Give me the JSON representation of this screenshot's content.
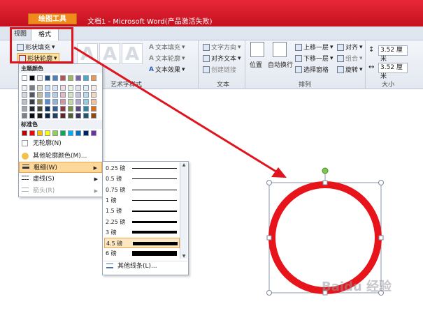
{
  "window": {
    "contextual_tab": "绘图工具",
    "title": "文档1 - Microsoft Word(产品激活失败)"
  },
  "tabs": {
    "view": "视图",
    "format": "格式"
  },
  "ribbon": {
    "shape_fill": "形状填充",
    "shape_outline": "形状轮廓",
    "wordart_group": "艺术字样式",
    "text_fill": "文本填充",
    "text_outline": "文本轮廓",
    "text_effects": "文本效果",
    "text_direction": "文字方向",
    "align_text": "对齐文本",
    "create_link": "创建链接",
    "text_group": "文本",
    "position": "位置",
    "wrap_text": "自动换行",
    "bring_forward": "上移一层",
    "send_backward": "下移一层",
    "selection_pane": "选择窗格",
    "align": "对齐",
    "group": "组合",
    "rotate": "旋转",
    "arrange_group": "排列",
    "height_value": "3.52 厘米",
    "width_value": "3.52 厘米",
    "size_group": "大小"
  },
  "outline_menu": {
    "theme_colors_header": "主题颜色",
    "standard_colors_header": "标准色",
    "no_outline": "无轮廓(N)",
    "more_colors": "其他轮廓颜色(M)...",
    "weight": "粗细(W)",
    "dashes": "虚线(S)",
    "arrows": "箭头(R)",
    "theme_colors": [
      [
        "#ffffff",
        "#000000",
        "#eeece1",
        "#1f497d",
        "#4f81bd",
        "#c0504d",
        "#9bbb59",
        "#8064a2",
        "#4bacc6",
        "#f79646"
      ],
      [
        "#f2f2f2",
        "#7f7f7f",
        "#ddd9c3",
        "#c6d9f0",
        "#dbe5f1",
        "#f2dcdb",
        "#ebf1dd",
        "#e5e0ec",
        "#dbeef3",
        "#fdeada"
      ],
      [
        "#d8d8d8",
        "#595959",
        "#c4bd97",
        "#8db3e2",
        "#b8cce4",
        "#e5b9b7",
        "#d7e3bc",
        "#ccc1d9",
        "#b7dde8",
        "#fbd5b5"
      ],
      [
        "#bfbfbf",
        "#3f3f3f",
        "#938953",
        "#548dd4",
        "#95b3d7",
        "#d99694",
        "#c3d69b",
        "#b2a2c7",
        "#92cddc",
        "#fac08f"
      ],
      [
        "#a5a5a5",
        "#262626",
        "#494429",
        "#17365d",
        "#366092",
        "#953734",
        "#76923c",
        "#5f497a",
        "#31859b",
        "#e36c09"
      ],
      [
        "#7f7f7f",
        "#0c0c0c",
        "#1d1b10",
        "#0f243e",
        "#244061",
        "#632423",
        "#4f6128",
        "#3f3151",
        "#205867",
        "#974806"
      ]
    ],
    "standard_colors": [
      "#c00000",
      "#ff0000",
      "#ffc000",
      "#ffff00",
      "#92d050",
      "#00b050",
      "#00b0f0",
      "#0070c0",
      "#002060",
      "#7030a0"
    ]
  },
  "weight_menu": {
    "options": [
      "0.25 磅",
      "0.5 磅",
      "0.75 磅",
      "1 磅",
      "1.5 磅",
      "2.25 磅",
      "3 磅",
      "4.5 磅",
      "6 磅"
    ],
    "more_lines": "其他线条(L)..."
  },
  "watermark": "Baidu 经验"
}
